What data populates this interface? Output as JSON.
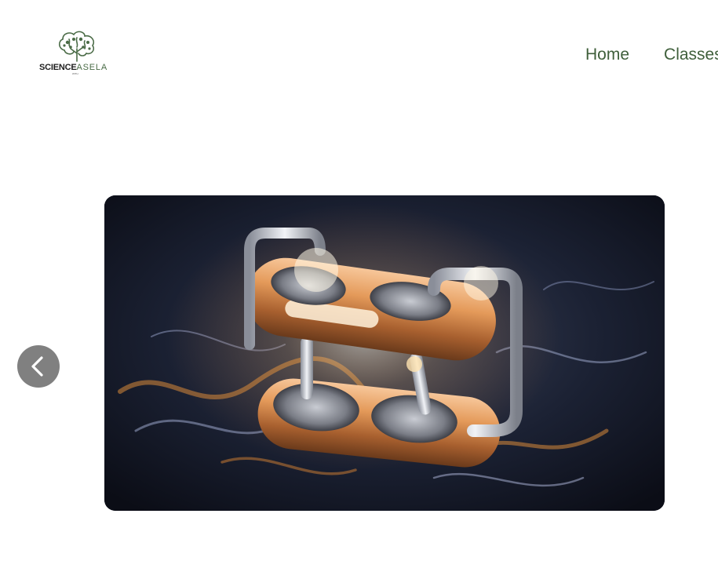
{
  "header": {
    "logo": {
      "word_bold": "SCIENCE",
      "word_light": "ASELA",
      "small_text": "WITH",
      "icon": "brain-tree-icon"
    },
    "nav": {
      "items": [
        {
          "label": "Home"
        },
        {
          "label": "Classes"
        }
      ]
    }
  },
  "slider": {
    "prev_icon": "chevron-left-icon",
    "slide_image": "glowing-copper-chrome-device-image"
  },
  "colors": {
    "brand_green": "#3f5f3b",
    "prev_button_bg": "#808080"
  }
}
